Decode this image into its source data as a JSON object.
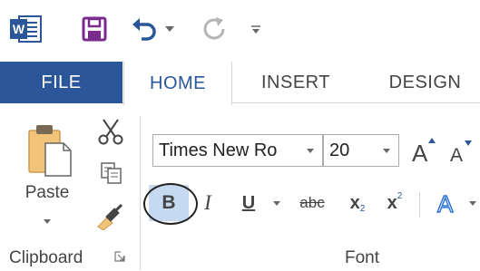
{
  "qat": {
    "app_icon": "word-logo-icon",
    "save_icon": "save-icon",
    "undo_icon": "undo-icon",
    "redo_icon": "redo-icon",
    "more_icon": "customize-toolbar-icon",
    "app_badge": "W"
  },
  "tabs": {
    "file": "FILE",
    "home": "HOME",
    "insert": "INSERT",
    "design": "DESIGN"
  },
  "clipboard": {
    "paste_label": "Paste",
    "group_label": "Clipboard"
  },
  "font": {
    "font_name": "Times New Ro",
    "font_size": "20",
    "bold": "B",
    "italic": "I",
    "underline": "U",
    "strikethrough": "abc",
    "subscript_base": "x",
    "subscript_mark": "2",
    "superscript_base": "x",
    "superscript_mark": "2",
    "grow_letter": "A",
    "shrink_letter": "A",
    "effects_letter": "A",
    "group_label": "Font"
  },
  "colors": {
    "file_tab": "#2b579a",
    "active_tab_text": "#2b579a",
    "bold_highlight": "#c5d9f1",
    "save_icon": "#7a2c8c",
    "undo_icon": "#2b579a",
    "effects_icon": "#2e75d6"
  }
}
